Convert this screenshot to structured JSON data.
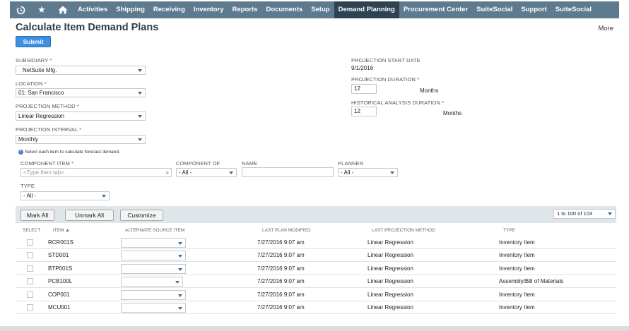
{
  "nav": {
    "items": [
      "Activities",
      "Shipping",
      "Receiving",
      "Inventory",
      "Reports",
      "Documents",
      "Setup",
      "Demand Planning",
      "Procurement Center",
      "SuiteSocial",
      "Support",
      "SuiteSocial"
    ],
    "active_index": 7
  },
  "page": {
    "title": "Calculate Item Demand Plans",
    "more": "More",
    "submit": "Submit"
  },
  "form": {
    "subsidiary": {
      "label": "SUBSIDIARY",
      "value": "NetSuite Mfg."
    },
    "location": {
      "label": "LOCATION",
      "value": "01: San Francisco"
    },
    "projection_method": {
      "label": "PROJECTION METHOD",
      "value": "Linear Regression"
    },
    "projection_interval": {
      "label": "PROJECTION INTERVAL",
      "value": "Monthly"
    },
    "projection_start_date": {
      "label": "PROJECTION START DATE",
      "value": "9/1/2016"
    },
    "projection_duration": {
      "label": "PROJECTION DURATION",
      "value": "12",
      "unit": "Months"
    },
    "historical_duration": {
      "label": "HISTORICAL ANALYSIS DURATION",
      "value": "12",
      "unit": "Months"
    },
    "required_mark": "*"
  },
  "filters": {
    "info": "Select each item to calculate forecast demand.",
    "component_item": {
      "label": "COMPONENT ITEM",
      "placeholder": "<Type then tab>"
    },
    "component_of": {
      "label": "COMPONENT OF",
      "value": "- All -"
    },
    "name": {
      "label": "NAME",
      "value": ""
    },
    "planner": {
      "label": "PLANNER",
      "value": "- All -"
    },
    "type": {
      "label": "TYPE",
      "value": "- All -"
    }
  },
  "grid": {
    "buttons": {
      "mark_all": "Mark All",
      "unmark_all": "Unmark All",
      "customize": "Customize"
    },
    "pager": "1 to 100 of 103",
    "headers": {
      "select": "SELECT",
      "item": "ITEM ▲",
      "alt_source": "ALTERNATE SOURCE ITEM",
      "last_plan": "LAST PLAN MODIFIED",
      "last_method": "LAST PROJECTION METHOD",
      "type": "TYPE"
    },
    "rows": [
      {
        "item": "RCR001S",
        "last_plan": "7/27/2016 9:07 am",
        "method": "Linear Regression",
        "type": "Inventory Item"
      },
      {
        "item": "STD001",
        "last_plan": "7/27/2016 9:07 am",
        "method": "Linear Regression",
        "type": "Inventory Item"
      },
      {
        "item": "BTP001S",
        "last_plan": "7/27/2016 9:07 am",
        "method": "Linear Regression",
        "type": "Inventory Item"
      },
      {
        "item": "PCB100L",
        "last_plan": "7/27/2016 9:07 am",
        "method": "Linear Regression",
        "type": "Assembly/Bill of Materials"
      },
      {
        "item": "COP001",
        "last_plan": "7/27/2016 9:07 am",
        "method": "Linear Regression",
        "type": "Inventory Item"
      },
      {
        "item": "MCU001",
        "last_plan": "7/27/2016 9:07 am",
        "method": "Linear Regression",
        "type": "Inventory Item"
      }
    ]
  },
  "icons": [
    "recent-icon",
    "star-icon",
    "home-icon",
    "info-icon",
    "dropdown-caret-icon",
    "double-chevron-icon"
  ],
  "colors": {
    "nav_bg": "#5e7a8f",
    "nav_active": "#2d4353",
    "submit": "#3d8fe0",
    "required": "#e08a1e",
    "caret": "#3a6da0"
  }
}
